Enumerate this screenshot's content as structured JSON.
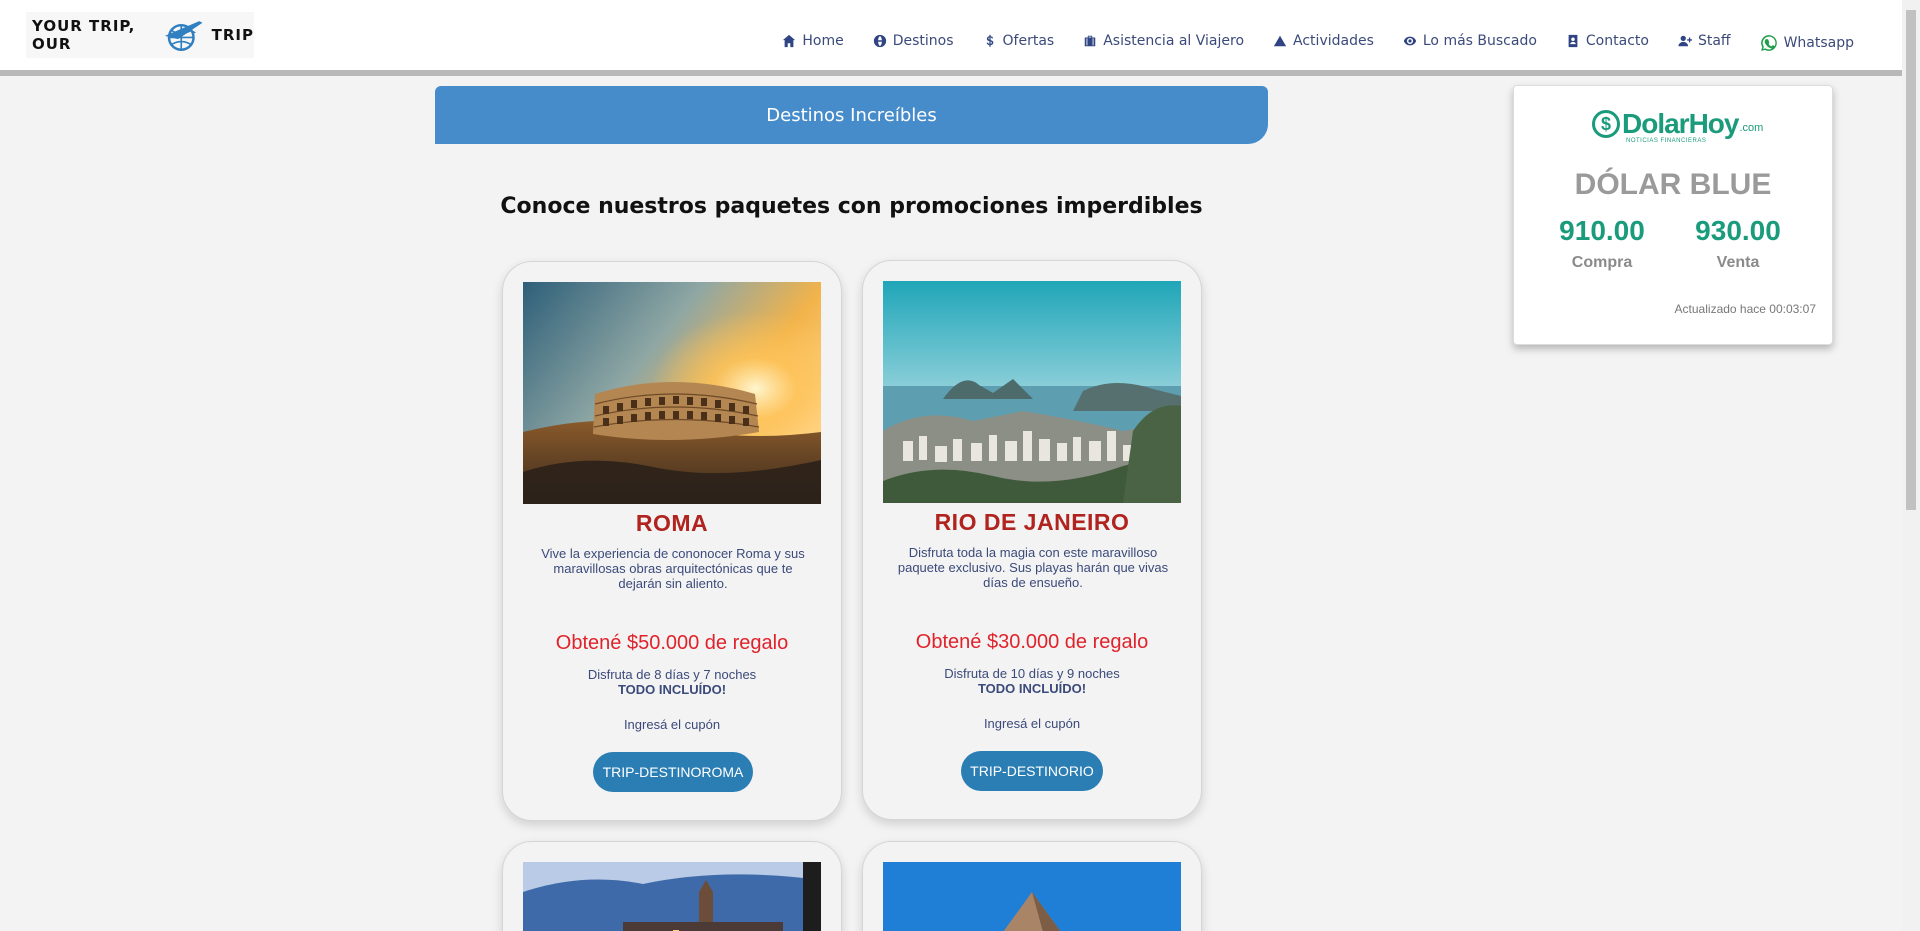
{
  "logo": {
    "text_left": "YOUR TRIP, OUR",
    "text_right": "TRIP"
  },
  "nav": [
    {
      "label": "Home",
      "icon": "home-icon"
    },
    {
      "label": "Destinos",
      "icon": "globe-icon"
    },
    {
      "label": "Ofertas",
      "icon": "dollar-icon"
    },
    {
      "label": "Asistencia al Viajero",
      "icon": "suitcase-icon"
    },
    {
      "label": "Actividades",
      "icon": "mountain-icon"
    },
    {
      "label": "Lo más Buscado",
      "icon": "eye-icon"
    },
    {
      "label": "Contacto",
      "icon": "contact-book-icon"
    },
    {
      "label": "Staff",
      "icon": "user-plus-icon"
    },
    {
      "label": "Whatsapp",
      "icon": "whatsapp-icon"
    }
  ],
  "section": {
    "title": "Destinos Increíbles",
    "headline": "Conoce nuestros paquetes con promociones imperdibles"
  },
  "cards": [
    {
      "title": "ROMA",
      "description": "Vive la experiencia de cononocer Roma y sus maravillosas obras arquitectónicas que te dejarán sin aliento.",
      "promo": "Obtené $50.000 de regalo",
      "duration": "Disfruta de 8 días y 7 noches",
      "included": "TODO INCLUÍDO!",
      "coupon_label": "Ingresá el cupón",
      "coupon": "TRIP-DESTINOROMA",
      "image": "colosseum-sunset"
    },
    {
      "title": "RIO DE JANEIRO",
      "description": "Disfruta toda la magia con este maravilloso paquete exclusivo. Sus playas harán que vivas días de ensueño.",
      "promo": "Obtené $30.000 de regalo",
      "duration": "Disfruta de 10 días y 9 noches",
      "included": "TODO INCLUÍDO!",
      "coupon_label": "Ingresá el cupón",
      "coupon": "TRIP-DESTINORIO",
      "image": "rio-aerial-view"
    }
  ],
  "dolar": {
    "brand": "DolarHoy",
    "brand_suffix": ".com",
    "tagline": "NOTICIAS FINANCIERAS",
    "title": "DÓLAR BLUE",
    "compra_value": "910.00",
    "compra_label": "Compra",
    "venta_value": "930.00",
    "venta_label": "Venta",
    "updated": "Actualizado hace 00:03:07"
  },
  "colors": {
    "accent_blue": "#468ccb",
    "title_red": "#b0231f",
    "promo_red": "#e0232b",
    "button_blue": "#2b7eb4",
    "dolar_green": "#1a9b7c"
  }
}
